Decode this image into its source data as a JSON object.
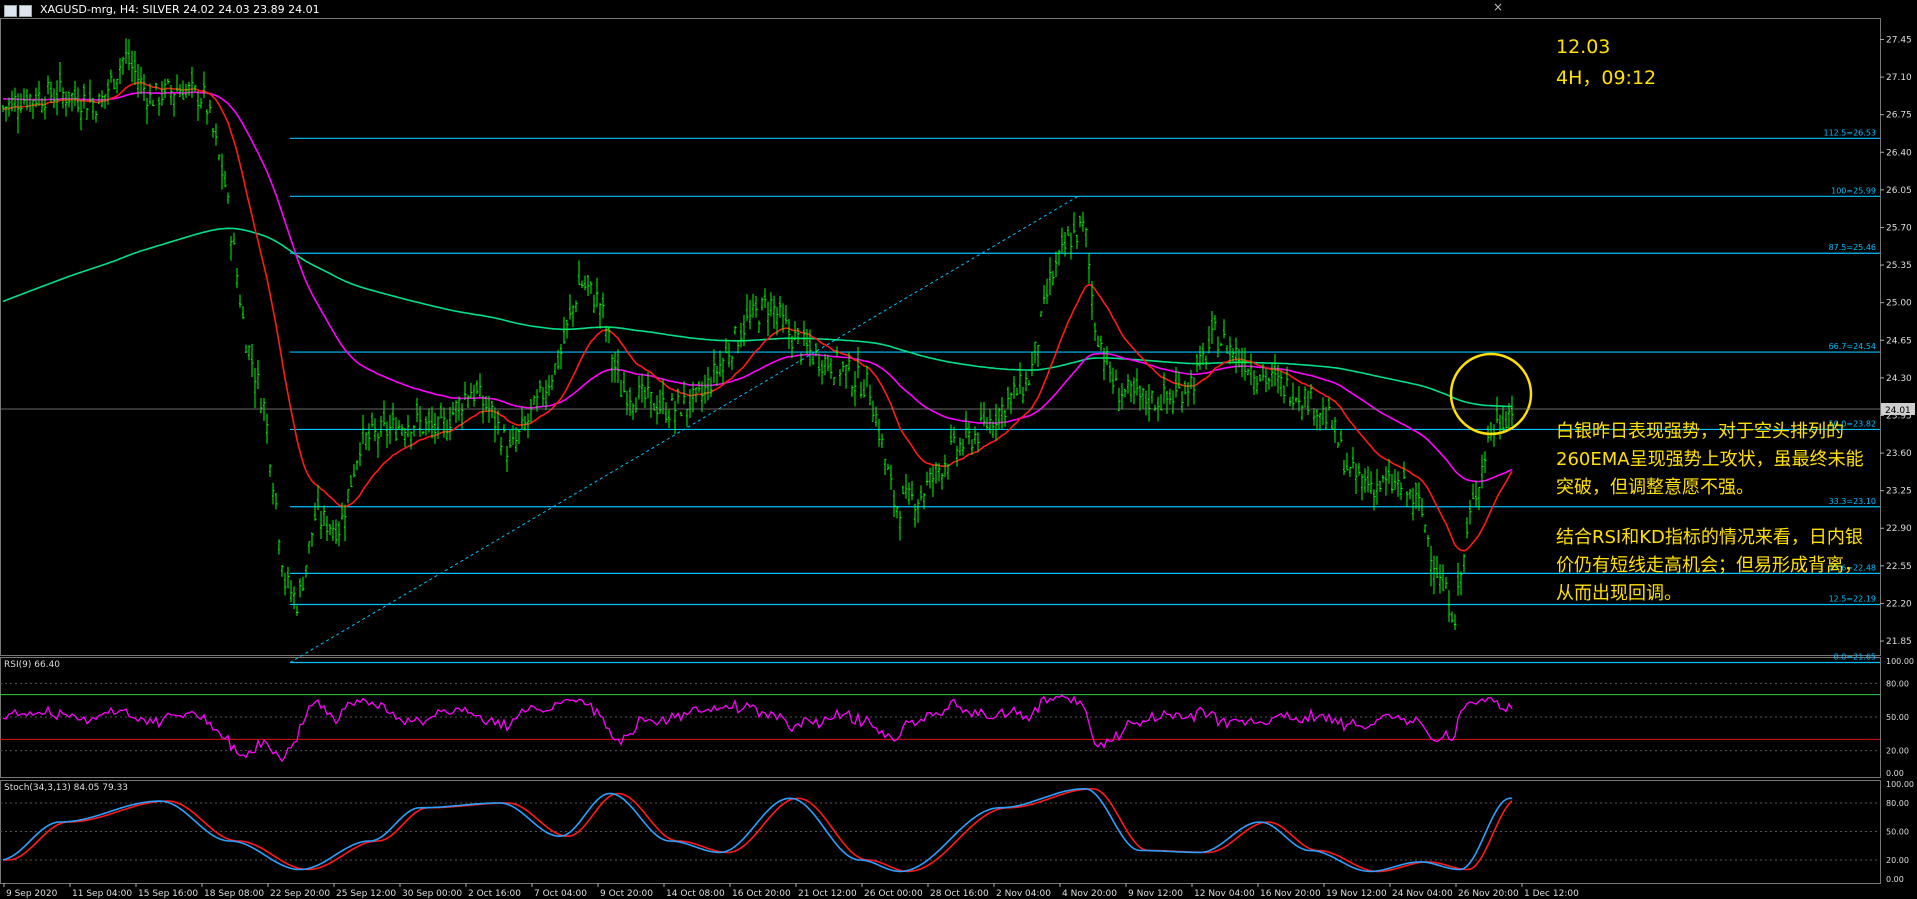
{
  "window": {
    "title": "XAGUSD-mrg, H4:  SILVER  24.02 24.03 23.89 24.01",
    "close_glyph": "×"
  },
  "colors": {
    "background": "#000000",
    "candle": "#00ff00",
    "fib": "#00bfff",
    "ema_red": "#ff1a1a",
    "ema_magenta": "#ff00ff",
    "ema_green": "#00e08a",
    "rsi": "#ff00ff",
    "stoch_main": "#2aa0ff",
    "stoch_signal": "#ff1a1a",
    "annotation": "#ffe000"
  },
  "price_axis": {
    "ticks": [
      "27.45",
      "27.10",
      "26.75",
      "26.40",
      "26.05",
      "25.70",
      "25.35",
      "25.00",
      "24.65",
      "24.30",
      "23.95",
      "23.60",
      "23.25",
      "22.90",
      "22.55",
      "22.20",
      "21.85"
    ],
    "current_price": "24.01",
    "range": [
      21.72,
      27.65
    ]
  },
  "fib_levels": [
    {
      "label": "112.5=26.53",
      "price": 26.53
    },
    {
      "label": "100=25.99",
      "price": 25.99
    },
    {
      "label": "87.5=25.46",
      "price": 25.46
    },
    {
      "label": "66.7=24.54",
      "price": 24.54
    },
    {
      "label": "50.0=23.82",
      "price": 23.82
    },
    {
      "label": "33.3=23.10",
      "price": 23.1
    },
    {
      "label": "23.6=22.48",
      "price": 22.48
    },
    {
      "label": "12.5=22.19",
      "price": 22.19
    },
    {
      "label": "0.0=21.65",
      "price": 21.65
    }
  ],
  "rsi": {
    "label": "RSI(9) 66.40",
    "ticks": [
      "100.00",
      "80.00",
      "50.00",
      "20.00",
      "0.00"
    ],
    "levels": [
      70,
      30
    ]
  },
  "stoch": {
    "label": "Stoch(34,3,13) 84.05 79.33",
    "ticks": [
      "100.00",
      "80.00",
      "50.00",
      "20.00",
      "0.00"
    ]
  },
  "time_axis": [
    "9 Sep 2020",
    "11 Sep 04:00",
    "15 Sep 16:00",
    "18 Sep 08:00",
    "22 Sep 20:00",
    "25 Sep 12:00",
    "30 Sep 00:00",
    "2 Oct 16:00",
    "7 Oct 04:00",
    "9 Oct 20:00",
    "14 Oct 08:00",
    "16 Oct 20:00",
    "21 Oct 12:00",
    "26 Oct 00:00",
    "28 Oct 16:00",
    "2 Nov 04:00",
    "4 Nov 20:00",
    "9 Nov 12:00",
    "12 Nov 04:00",
    "16 Nov 20:00",
    "19 Nov 12:00",
    "24 Nov 04:00",
    "26 Nov 20:00",
    "1 Dec 12:00"
  ],
  "annotations": {
    "date": "12.03",
    "timeframe": "4H，09:12",
    "paragraph1": "白银昨日表现强势，对于空头排列的260EMA呈现强势上攻状，虽最终未能突破，但调整意愿不强。",
    "paragraph2": "结合RSI和KD指标的情况来看，日内银价仍有短线走高机会；但易形成背离，从而出现回调。"
  }
}
